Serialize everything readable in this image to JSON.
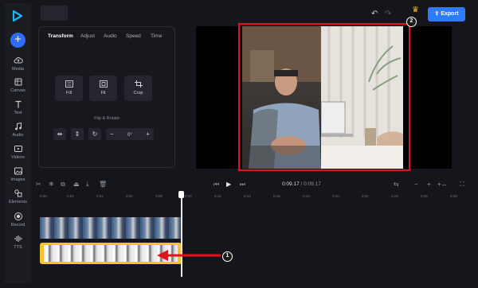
{
  "sidebar": {
    "items": [
      {
        "label": "Media",
        "icon": "cloud-upload-icon"
      },
      {
        "label": "Canvas",
        "icon": "canvas-icon"
      },
      {
        "label": "Text",
        "icon": "text-icon"
      },
      {
        "label": "Audio",
        "icon": "music-note-icon"
      },
      {
        "label": "Videos",
        "icon": "video-play-icon"
      },
      {
        "label": "Images",
        "icon": "image-icon"
      },
      {
        "label": "Elements",
        "icon": "shapes-icon"
      },
      {
        "label": "Record",
        "icon": "record-icon"
      },
      {
        "label": "TTS",
        "icon": "waveform-icon"
      }
    ]
  },
  "header": {
    "export_label": "Export"
  },
  "panel": {
    "tabs": [
      "Transform",
      "Adjust",
      "Audio",
      "Speed",
      "Time"
    ],
    "active_tab": "Transform",
    "tools": [
      {
        "label": "Fill"
      },
      {
        "label": "Fit"
      },
      {
        "label": "Crop"
      }
    ],
    "flip_rotate_title": "Flip & Rotate",
    "rotation_value": "0°"
  },
  "timeline": {
    "current_time": "0:09.17",
    "separator": "/",
    "total_time": "0:09.17",
    "ruler_ticks": [
      "0:00",
      "0:02",
      "0:04",
      "0:06",
      "0:08",
      "0:10",
      "0:12",
      "0:14",
      "0:16",
      "0:18",
      "0:20",
      "0:22",
      "0:24",
      "0:26",
      "0:28",
      "0:30"
    ]
  },
  "annotations": {
    "callout_1": "1",
    "callout_2": "2"
  },
  "colors": {
    "accent": "#2f7bff",
    "highlight": "#e0141e",
    "clip_selected": "#f1c232"
  }
}
